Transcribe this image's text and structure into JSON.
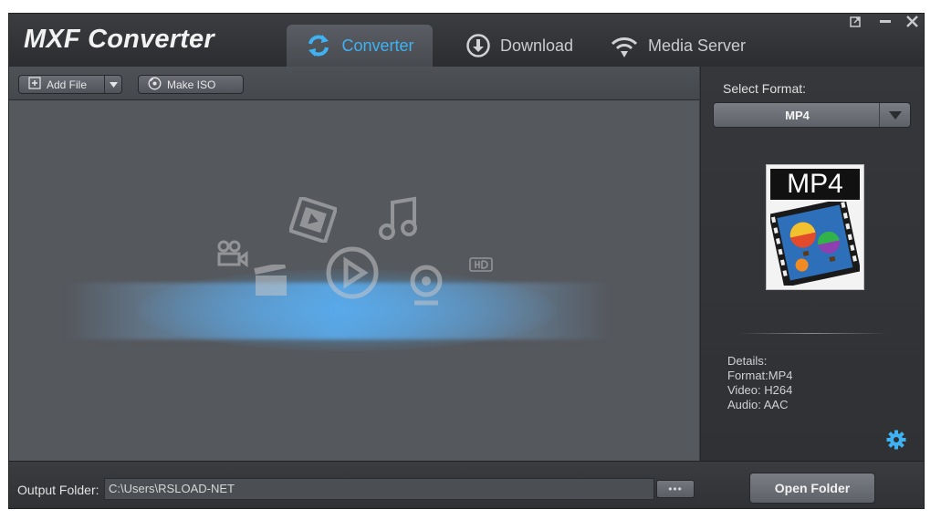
{
  "app": {
    "title": "MXF Converter"
  },
  "tabs": [
    {
      "label": "Converter",
      "icon": "refresh-icon",
      "active": true
    },
    {
      "label": "Download",
      "icon": "download-icon",
      "active": false
    },
    {
      "label": "Media Server",
      "icon": "wifi-icon",
      "active": false
    }
  ],
  "window_controls": {
    "restore_icon": "popout-icon",
    "minimize_icon": "minimize-icon",
    "close_icon": "close-icon"
  },
  "toolbar": {
    "add_file_label": "Add File",
    "make_iso_label": "Make ISO"
  },
  "format_panel": {
    "select_label": "Select Format:",
    "selected_format": "MP4",
    "thumbnail_label": "MP4",
    "details": [
      "Details:",
      "Format:MP4",
      "Video: H264",
      "Audio: AAC"
    ]
  },
  "output": {
    "label": "Output Folder:",
    "path": "C:\\Users\\RSLOAD-NET",
    "browse_label": "•••",
    "open_folder_label": "Open Folder"
  },
  "colors": {
    "accent": "#3fb2f3"
  }
}
